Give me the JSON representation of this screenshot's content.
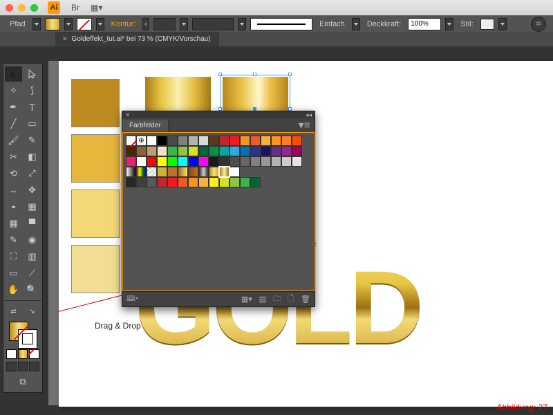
{
  "titlebar": {
    "app_badge": "Ai"
  },
  "controlbar": {
    "path_label": "Pfad",
    "stroke_label": "Kontur:",
    "stroke_style_label": "Einfach",
    "opacity_label": "Deckkraft:",
    "opacity_value": "100%",
    "style_label": "Stil:"
  },
  "doctab": {
    "title": "Goldeffekt_tut.ai* bei 73 % (CMYK/Vorschau)"
  },
  "canvas": {
    "gold_text": "GOLD"
  },
  "panel": {
    "title": "Farbfelder",
    "swatches_row1": [
      "none",
      "reg",
      "#ffffff",
      "#000000",
      "#4a4a4a",
      "#808080",
      "#b3b3b3",
      "#d9d9d9",
      "#5b3a1a",
      "#c1272d",
      "#ed1c24",
      "#f7931e",
      "#f15a24",
      "#fbb03b",
      "#ff931e",
      "#ff7f27",
      "#ff4d00"
    ],
    "swatches_row2": [
      "#4d2600",
      "#8c6239",
      "#c69c6d",
      "#f0e2c6",
      "#39b54a",
      "#8cc63f",
      "#d9e021",
      "#006837",
      "#009245",
      "#00a99d",
      "#29abe2",
      "#0071bc",
      "#2e3192",
      "#1b1464",
      "#662d91",
      "#93278f",
      "#9e005d"
    ],
    "swatches_row3": [
      "#ed1e79",
      "#ffffff",
      "#ff0000",
      "#ffff00",
      "#00ff00",
      "#00ffff",
      "#0000ff",
      "#ff00ff",
      "#1a1a1a",
      "#333333",
      "#4d4d4d",
      "#666666",
      "#808080",
      "#999999",
      "#b3b3b3",
      "#cccccc",
      "#e6e6e6"
    ],
    "gradients": [
      "linear-gradient(90deg,#fff,#000)",
      "linear-gradient(90deg,red,yellow,green,blue)",
      "repeating-conic-gradient(#ccc 0 25%,#fff 0 50%) 0 0/6px 6px",
      "#d4af37",
      "#b87333",
      "linear-gradient(90deg,#9d6f12,#f6e27a)",
      "linear-gradient(90deg,#8B4513,#D2691E)",
      "linear-gradient(90deg,#333,#ccc,#333)",
      "linear-gradient(90deg,#b88a1e,#f7e37a,#d9a72a)",
      "linear-gradient(90deg,#a97b18,#fbefb1,#a47618)",
      "#fff"
    ],
    "swatches_row5": [
      "#262626",
      "#404040",
      "#595959",
      "#c1272d",
      "#ed1c24",
      "#f15a24",
      "#f7931e",
      "#fbb03b",
      "#fcee21",
      "#d9e021",
      "#8cc63f",
      "#39b54a",
      "#006837"
    ]
  },
  "annotation": {
    "dragdrop": "Drag & Drop"
  },
  "figure_label": "Abbildung: 27"
}
